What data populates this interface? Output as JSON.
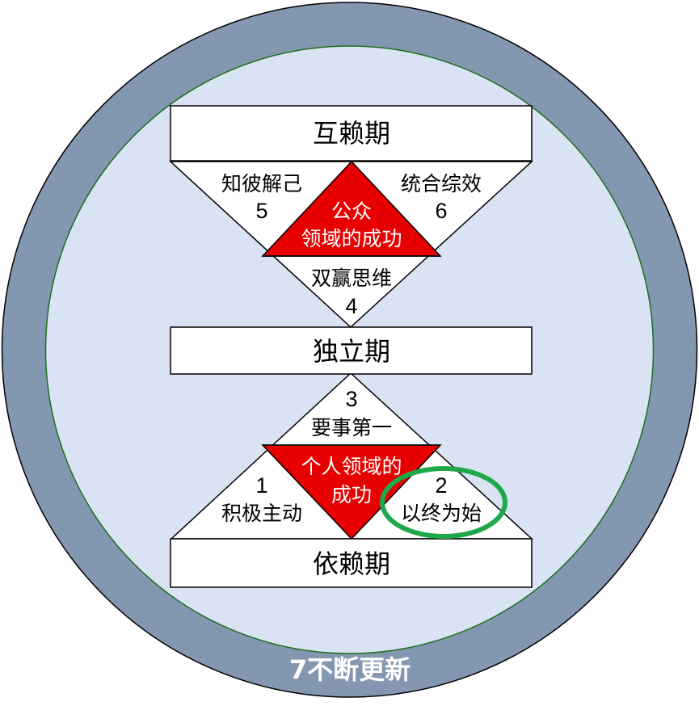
{
  "stages": {
    "interdependence": "互赖期",
    "independence": "独立期",
    "dependence": "依赖期"
  },
  "habits": {
    "h1": {
      "number": "1",
      "label": "积极主动"
    },
    "h2": {
      "number": "2",
      "label": "以终为始"
    },
    "h3": {
      "number": "3",
      "label": "要事第一"
    },
    "h4": {
      "label": "双赢思维",
      "number": "4"
    },
    "h5": {
      "label": "知彼解己",
      "number": "5"
    },
    "h6": {
      "label": "统合综效",
      "number": "6"
    }
  },
  "victories": {
    "public_line1": "公众",
    "public_line2": "领域的成功",
    "private_line1": "个人领域的",
    "private_line2": "成功"
  },
  "ring_label": "7不断更新",
  "highlight": {
    "target": "h2",
    "color": "#1fa84a"
  },
  "colors": {
    "outer_ring": "#8497b0",
    "inner_circle": "#dae3f3",
    "inner_border": "#1e6e1e",
    "victory_triangle": "#e60000",
    "box_fill": "#ffffff",
    "stroke": "#000000"
  }
}
